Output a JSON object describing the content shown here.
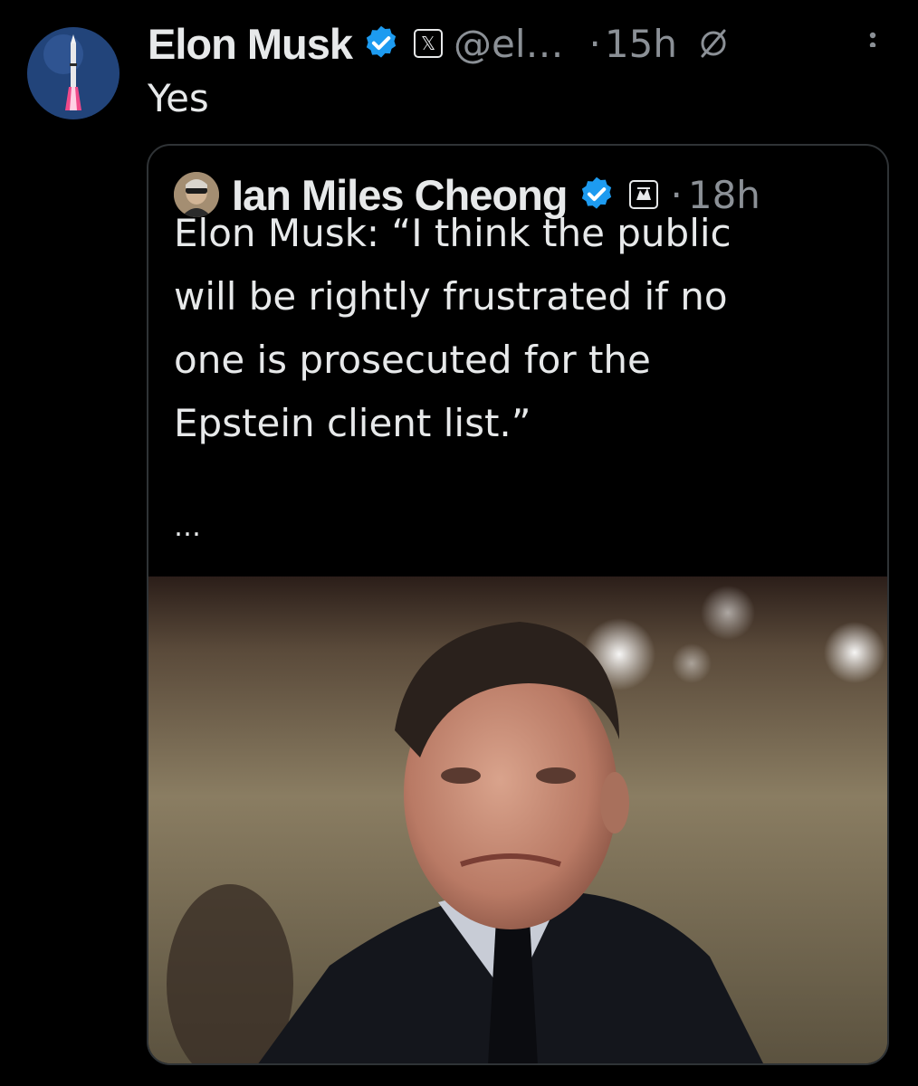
{
  "tweet": {
    "author_name": "Elon Musk",
    "affiliation_glyph": "𝕏",
    "handle": "@el…",
    "dot": "·",
    "time": "15h",
    "text": "Yes",
    "avatar_icon": "rocket-launch-avatar",
    "verified_color": "#1d9bf0"
  },
  "quote": {
    "author_name": "Ian Miles Cheong",
    "dot": "·",
    "time": "18h",
    "lines": [
      "Elon Musk: “I think the public",
      "will be rightly frustrated if no",
      "one is prosecuted for the",
      "Epstein client list.”"
    ],
    "ellipsis": "…",
    "image_icon": "portrait-photo"
  },
  "colors": {
    "background": "#000000",
    "text": "#e7e9ea",
    "muted": "#8b9096",
    "border": "#2f3336",
    "verified": "#1d9bf0"
  }
}
